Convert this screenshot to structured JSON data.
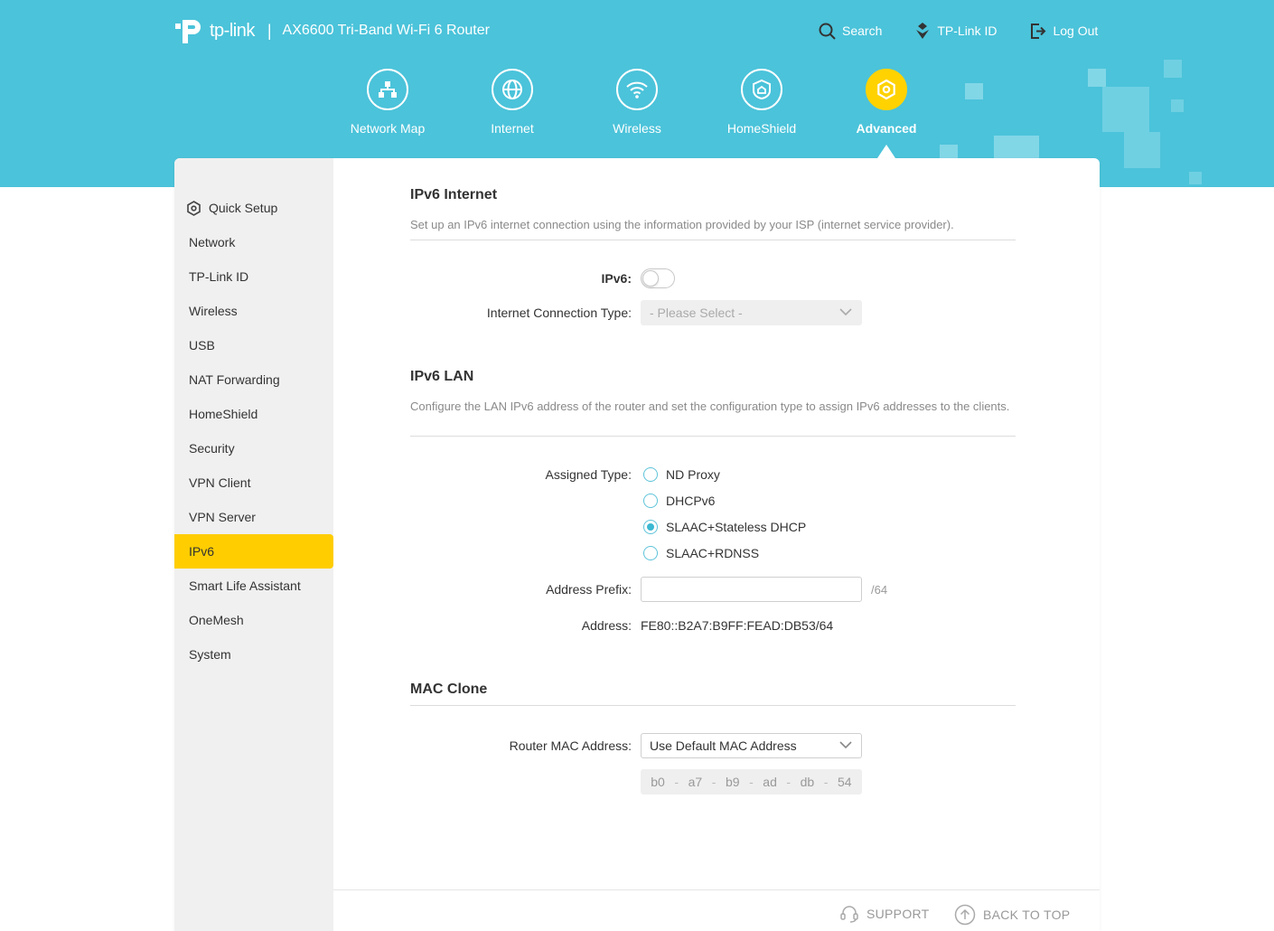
{
  "brand": {
    "logo_text": "tp-link",
    "separator": "|",
    "product": "AX6600 Tri-Band Wi-Fi 6 Router"
  },
  "top_links": {
    "search": "Search",
    "tplink_id": "TP-Link ID",
    "logout": "Log Out"
  },
  "main_nav": {
    "items": [
      {
        "label": "Network Map",
        "icon": "network-map-icon"
      },
      {
        "label": "Internet",
        "icon": "globe-icon"
      },
      {
        "label": "Wireless",
        "icon": "wifi-icon"
      },
      {
        "label": "HomeShield",
        "icon": "homeshield-icon"
      },
      {
        "label": "Advanced",
        "icon": "advanced-gear-icon",
        "active": true
      }
    ]
  },
  "sidebar": {
    "items": [
      {
        "label": "Quick Setup",
        "icon": "gear-icon"
      },
      {
        "label": "Network"
      },
      {
        "label": "TP-Link ID"
      },
      {
        "label": "Wireless"
      },
      {
        "label": "USB"
      },
      {
        "label": "NAT Forwarding"
      },
      {
        "label": "HomeShield"
      },
      {
        "label": "Security"
      },
      {
        "label": "VPN Client"
      },
      {
        "label": "VPN Server"
      },
      {
        "label": "IPv6",
        "active": true
      },
      {
        "label": "Smart Life Assistant"
      },
      {
        "label": "OneMesh"
      },
      {
        "label": "System"
      }
    ]
  },
  "ipv6_internet": {
    "title": "IPv6 Internet",
    "description": "Set up an IPv6 internet connection using the information provided by your ISP (internet service provider).",
    "ipv6_label": "IPv6:",
    "ipv6_enabled": false,
    "connection_type_label": "Internet Connection Type:",
    "connection_type_placeholder": "- Please Select -"
  },
  "ipv6_lan": {
    "title": "IPv6 LAN",
    "description": "Configure the LAN IPv6 address of the router and set the configuration type to assign IPv6 addresses to the clients.",
    "assigned_type_label": "Assigned Type:",
    "assigned_type_options": [
      "ND Proxy",
      "DHCPv6",
      "SLAAC+Stateless DHCP",
      "SLAAC+RDNSS"
    ],
    "assigned_type_selected": "SLAAC+Stateless DHCP",
    "address_prefix_label": "Address Prefix:",
    "address_prefix_value": "",
    "address_prefix_suffix": "/64",
    "address_label": "Address:",
    "address_value": "FE80::B2A7:B9FF:FEAD:DB53/64"
  },
  "mac_clone": {
    "title": "MAC Clone",
    "router_mac_label": "Router MAC Address:",
    "router_mac_selected": "Use Default MAC Address",
    "mac_octets": [
      "b0",
      "a7",
      "b9",
      "ad",
      "db",
      "54"
    ],
    "mac_separator": "-"
  },
  "footer": {
    "support": "SUPPORT",
    "back_to_top": "BACK TO TOP"
  },
  "colors": {
    "header": "#4bc3da",
    "accent": "#ffcd00",
    "radio": "#3cb8d2"
  }
}
